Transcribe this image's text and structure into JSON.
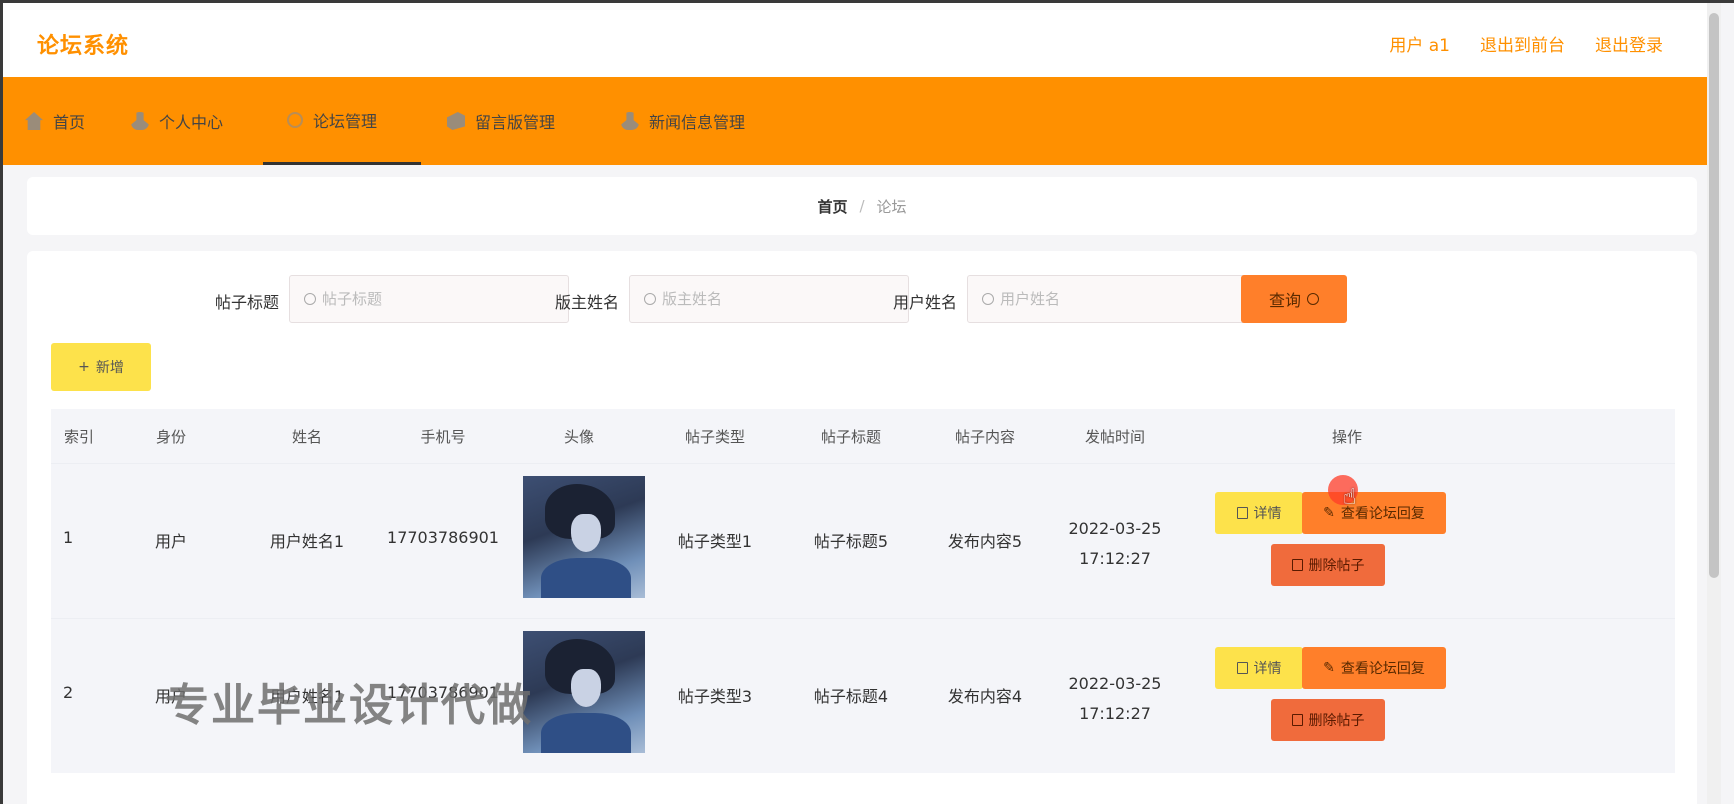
{
  "header": {
    "brand": "论坛系统",
    "user": "用户 a1",
    "to_front": "退出到前台",
    "logout": "退出登录"
  },
  "nav": {
    "items": [
      {
        "label": "首页",
        "icon": "home-icon"
      },
      {
        "label": "个人中心",
        "icon": "user-icon"
      },
      {
        "label": "论坛管理",
        "icon": "forum-icon",
        "active": true
      },
      {
        "label": "留言版管理",
        "icon": "message-icon"
      },
      {
        "label": "新闻信息管理",
        "icon": "news-icon"
      }
    ]
  },
  "breadcrumb": {
    "home": "首页",
    "separator": "/",
    "current": "论坛"
  },
  "search": {
    "title_label": "帖子标题",
    "title_placeholder": "帖子标题",
    "owner_label": "版主姓名",
    "owner_placeholder": "版主姓名",
    "user_label": "用户姓名",
    "user_placeholder": "用户姓名",
    "query_label": "查询"
  },
  "toolbar": {
    "add_label": "新增"
  },
  "table": {
    "columns": [
      "索引",
      "身份",
      "姓名",
      "手机号",
      "头像",
      "帖子类型",
      "帖子标题",
      "帖子内容",
      "发帖时间",
      "操作"
    ],
    "rows": [
      {
        "index": "1",
        "role": "用户",
        "name": "用户姓名1",
        "phone": "17703786901",
        "type": "帖子类型1",
        "title": "帖子标题5",
        "content": "发布内容5",
        "time": "2022-03-25 17:12:27"
      },
      {
        "index": "2",
        "role": "用户",
        "name": "用户姓名1",
        "phone": "17703786901",
        "type": "帖子类型3",
        "title": "帖子标题4",
        "content": "发布内容4",
        "time": "2022-03-25 17:12:27"
      }
    ],
    "actions": {
      "detail": "详情",
      "reply": "查看论坛回复",
      "delete": "删除帖子"
    }
  },
  "watermark": "专业毕业设计代做",
  "colors": {
    "accent": "#ff9000",
    "query_button": "#ff7f2a",
    "add_button": "#fde24b",
    "delete_button": "#f06b3c"
  }
}
